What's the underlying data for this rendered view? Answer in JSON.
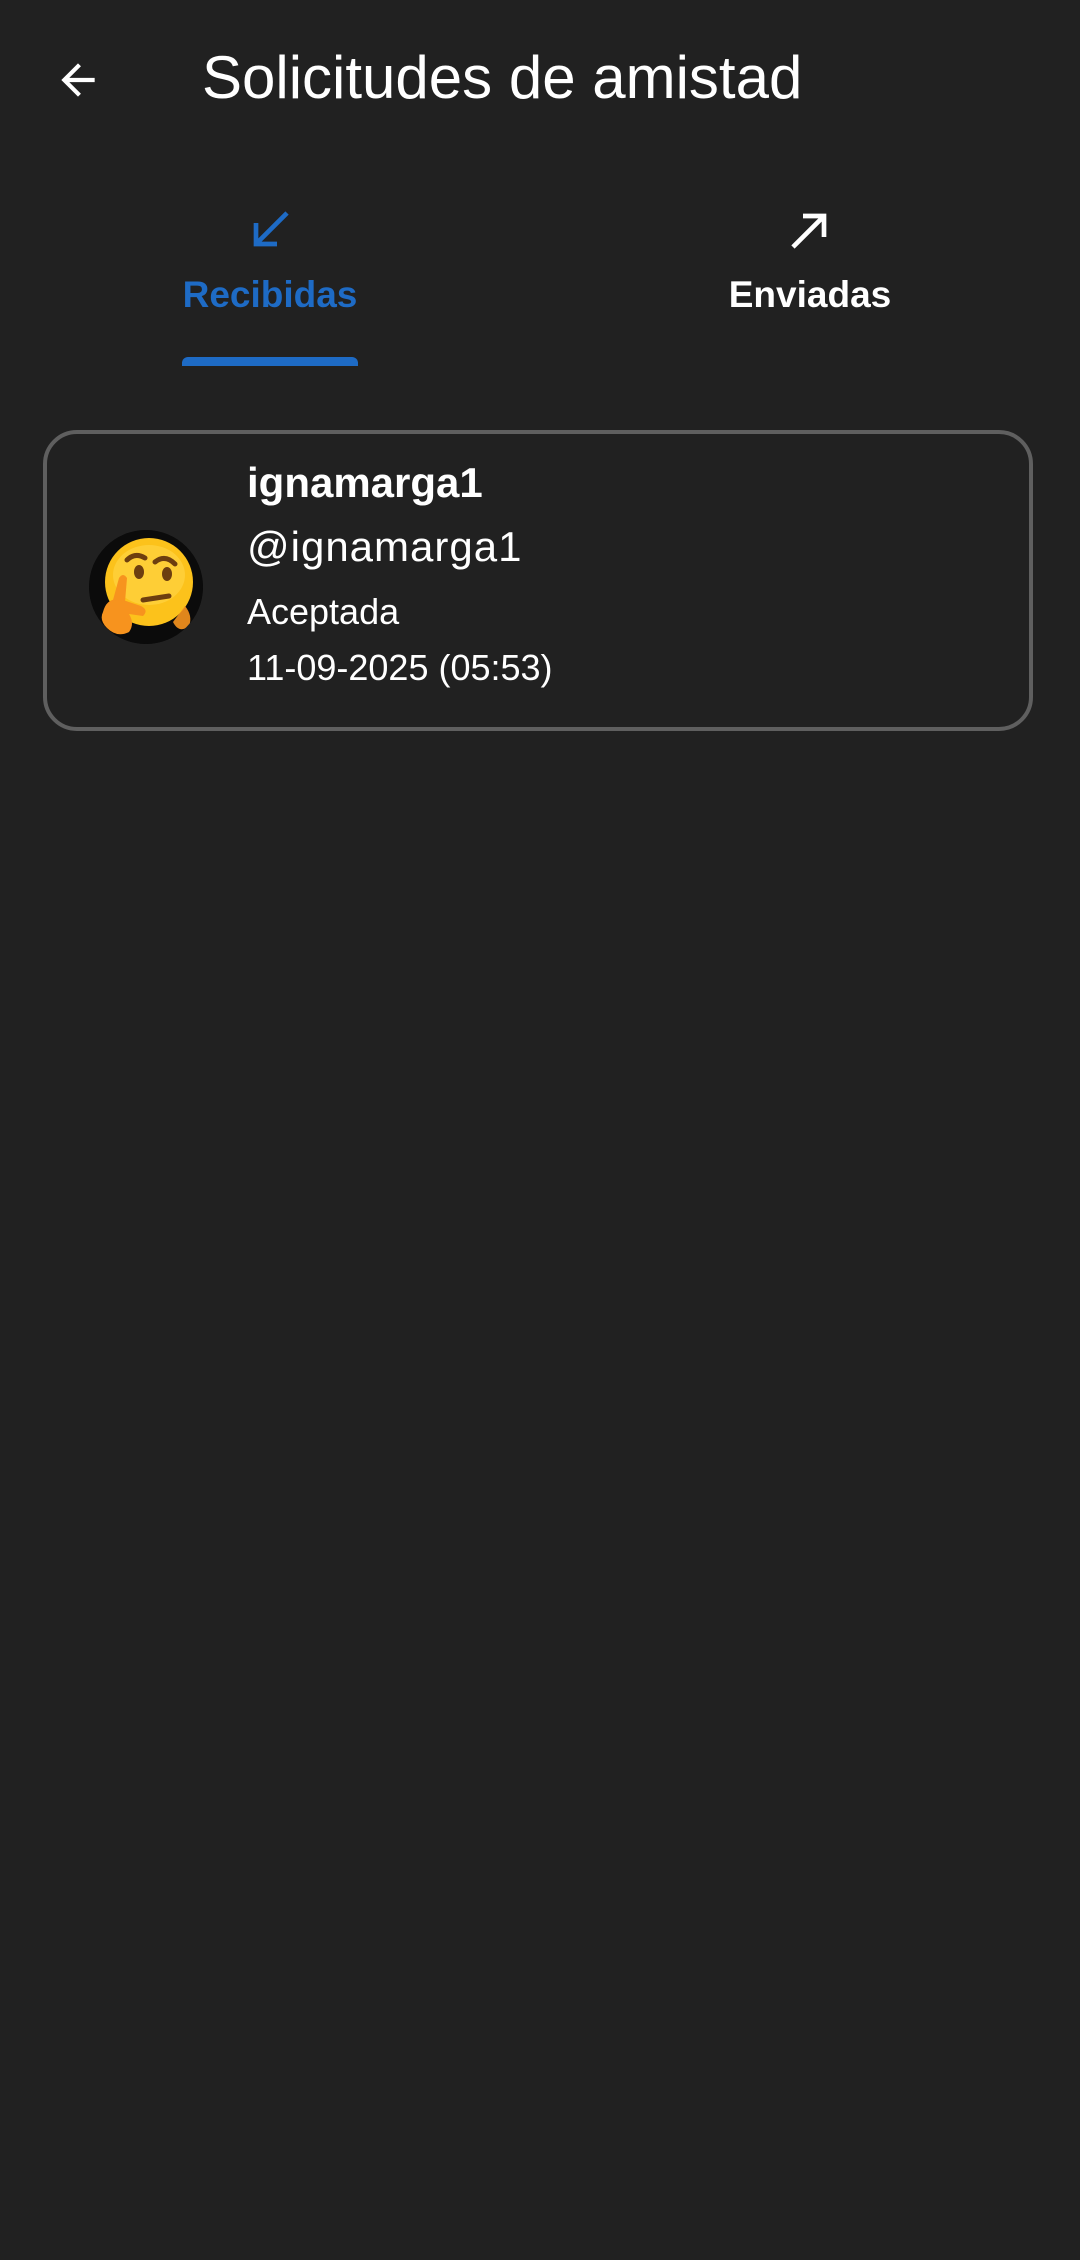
{
  "header": {
    "title": "Solicitudes de amistad",
    "back_icon": "arrow-left-icon"
  },
  "tabs": [
    {
      "label": "Recibidas",
      "icon": "arrow-down-left-icon",
      "selected": true
    },
    {
      "label": "Enviadas",
      "icon": "arrow-up-right-icon",
      "selected": false
    }
  ],
  "colors": {
    "background": "#212121",
    "accent": "#1e6bc5",
    "card_border": "#5f5f5f",
    "text": "#ffffff"
  },
  "requests": [
    {
      "display_name": "ignamarga1",
      "username": "@ignamarga1",
      "status": "Aceptada",
      "date": "11-09-2025 (05:53)",
      "avatar_icon": "thinking-face-emoji-icon"
    }
  ]
}
